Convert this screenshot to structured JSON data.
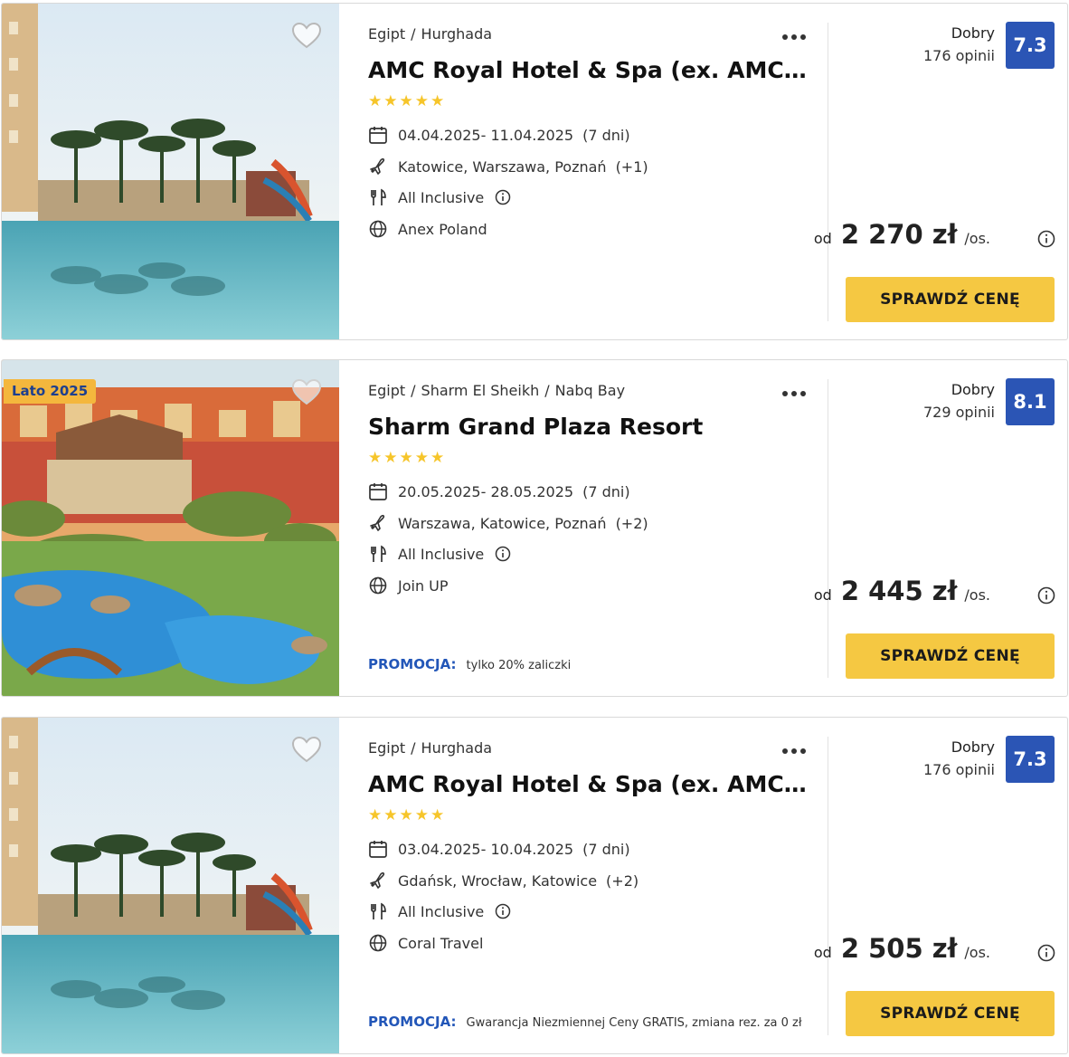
{
  "offers": [
    {
      "crumbs": [
        "Egipt",
        "Hurghada"
      ],
      "title": "AMC Royal Hotel & Spa (ex. AMC Azur Resort)",
      "stars": 5,
      "dates": "04.04.2025- 11.04.2025",
      "duration": "(7 dni)",
      "departures": "Katowice, Warszawa, Poznań",
      "departures_more": "(+1)",
      "board": "All Inclusive",
      "operator": "Anex Poland",
      "promo_label": "",
      "promo_text": "",
      "season_badge": "",
      "rating_label": "Dobry",
      "rating_count": "176 opinii",
      "rating_score": "7.3",
      "price_prefix": "od",
      "price": "2 270 zł",
      "price_suffix": "/os.",
      "cta": "SPRAWDŹ CENĘ"
    },
    {
      "crumbs": [
        "Egipt",
        "Sharm El Sheikh",
        "Nabq Bay"
      ],
      "title": "Sharm Grand Plaza Resort",
      "stars": 5,
      "dates": "20.05.2025- 28.05.2025",
      "duration": "(7 dni)",
      "departures": "Warszawa, Katowice, Poznań",
      "departures_more": "(+2)",
      "board": "All Inclusive",
      "operator": "Join UP",
      "promo_label": "PROMOCJA:",
      "promo_text": "tylko 20% zaliczki",
      "season_badge": "Lato 2025",
      "rating_label": "Dobry",
      "rating_count": "729 opinii",
      "rating_score": "8.1",
      "price_prefix": "od",
      "price": "2 445 zł",
      "price_suffix": "/os.",
      "cta": "SPRAWDŹ CENĘ"
    },
    {
      "crumbs": [
        "Egipt",
        "Hurghada"
      ],
      "title": "AMC Royal Hotel & Spa (ex. AMC Azur Resort)",
      "stars": 5,
      "dates": "03.04.2025- 10.04.2025",
      "duration": "(7 dni)",
      "departures": "Gdańsk, Wrocław, Katowice",
      "departures_more": "(+2)",
      "board": "All Inclusive",
      "operator": "Coral Travel",
      "promo_label": "PROMOCJA:",
      "promo_text": "Gwarancja Niezmiennej Ceny GRATIS, zmiana rez. za 0 zł",
      "season_badge": "",
      "rating_label": "Dobry",
      "rating_count": "176 opinii",
      "rating_score": "7.3",
      "price_prefix": "od",
      "price": "2 505 zł",
      "price_suffix": "/os.",
      "cta": "SPRAWDŹ CENĘ"
    }
  ],
  "colors": {
    "accent_button": "#f5c842",
    "rating_box": "#2b55b5",
    "promo_label": "#2256b8",
    "season_badge": "#f4b73d",
    "star": "#f6c52a"
  },
  "icons": {
    "favorite": "heart-icon",
    "more": "more-dots-icon",
    "dates": "calendar-icon",
    "departures": "plane-icon",
    "board": "cutlery-icon",
    "operator": "globe-icon",
    "info": "info-icon",
    "rating": "star-icon"
  }
}
